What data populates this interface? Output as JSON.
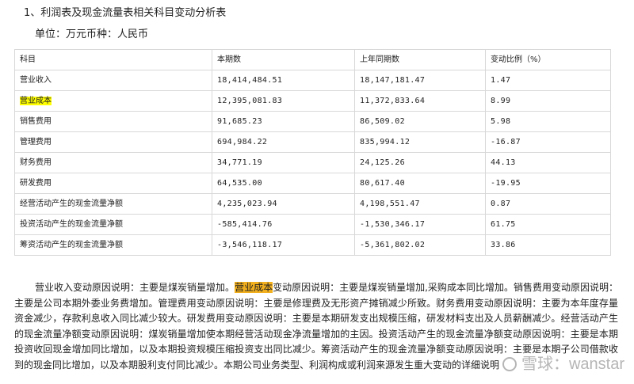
{
  "heading": "1、利润表及现金流量表相关科目变动分析表",
  "unit_line": "单位：万元币种：人民币",
  "table": {
    "headers": [
      "科目",
      "本期数",
      "上年同期数",
      "变动比例（%）"
    ],
    "rows": [
      {
        "subject": "营业收入",
        "current": "18,414,484.51",
        "previous": "18,147,181.47",
        "change": "1.47",
        "highlight": false
      },
      {
        "subject": "营业成本",
        "current": "12,395,081.83",
        "previous": "11,372,833.64",
        "change": "8.99",
        "highlight": true
      },
      {
        "subject": "销售费用",
        "current": "91,685.23",
        "previous": "86,509.02",
        "change": "5.98",
        "highlight": false
      },
      {
        "subject": "管理费用",
        "current": "694,984.22",
        "previous": "835,994.12",
        "change": "-16.87",
        "highlight": false
      },
      {
        "subject": "财务费用",
        "current": "34,771.19",
        "previous": "24,125.26",
        "change": "44.13",
        "highlight": false
      },
      {
        "subject": "研发费用",
        "current": "64,535.00",
        "previous": "80,617.40",
        "change": "-19.95",
        "highlight": false
      },
      {
        "subject": "经营活动产生的现金流量净额",
        "current": "4,235,023.94",
        "previous": "4,198,551.47",
        "change": "0.87",
        "highlight": false
      },
      {
        "subject": "投资活动产生的现金流量净额",
        "current": "-585,414.76",
        "previous": "-1,530,346.17",
        "change": "61.75",
        "highlight": false
      },
      {
        "subject": "筹资活动产生的现金流量净额",
        "current": "-3,546,118.17",
        "previous": "-5,361,802.02",
        "change": "33.86",
        "highlight": false
      }
    ]
  },
  "paragraph": {
    "before_highlight": "营业收入变动原因说明：主要是煤炭销量增加。",
    "highlight": "营业成本",
    "after_highlight": "变动原因说明：主要是煤炭销量增加,采购成本同比增加。销售费用变动原因说明：主要是公司本期外委业务费增加。管理费用变动原因说明：主要是修理费及无形资产摊销减少所致。财务费用变动原因说明：主要为本年度存量资金减少，存款利息收入同比减少较大。研发费用变动原因说明：主要是本期研发支出规模压缩，研发材料支出及人员薪酬减少。经营活动产生的现金流量净额变动原因说明：煤炭销量增加使本期经营活动现金净流量增加的主因。投资活动产生的现金流量净额变动原因说明：主要是本期投资收回现金增加同比增加，以及本期投资规模压缩投资支出同比减少。筹资活动产生的现金流量净额变动原因说明：主要是本期子公司借款收到的现金同比增加，以及本期股利支付同比减少。本期公司业务类型、利润构成或利润来源发生重大变动的详细说明"
  },
  "watermark": "雪球：wanstar",
  "colors": {
    "table_highlight": "#ffff00",
    "text_highlight": "#f2b01e",
    "border": "#d8d8d8"
  }
}
